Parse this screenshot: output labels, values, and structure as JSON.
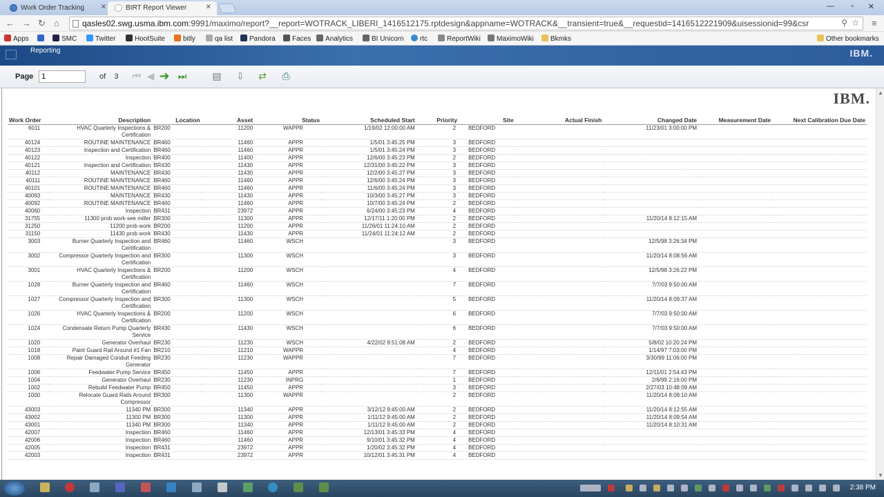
{
  "browser": {
    "tabs": [
      {
        "label": "Work Order Tracking",
        "active": false
      },
      {
        "label": "BIRT Report Viewer",
        "active": true
      }
    ],
    "url_host": "qasles02.swg.usma.ibm.com",
    "url_rest": ":9991/maximo/report?__report=WOTRACK_LIBERI_1416512175.rptdesign&appname=WOTRACK&__transient=true&__requestid=1416512221909&uisessionid=99&csr",
    "bookmarks": [
      "Apps",
      "SMC",
      "Twitter",
      "HootSuite",
      "bitly",
      "qa list",
      "Pandora",
      "Faces",
      "Analytics",
      "BI Unicorn",
      "rtc",
      "ReportWiki",
      "MaximoWiki",
      "Bkmks"
    ],
    "other_bookmarks": "Other bookmarks"
  },
  "app": {
    "section": "Reporting",
    "brand": "IBM."
  },
  "toolbar": {
    "page_label": "Page",
    "page_value": "1",
    "of_label": "of",
    "total_pages": "3"
  },
  "report": {
    "logo": "IBM.",
    "columns": [
      "Work Order",
      "Description",
      "Location",
      "Asset",
      "Status",
      "Scheduled Start",
      "Priority",
      "Site",
      "Actual Finish",
      "Changed Date",
      "Measurement Date",
      "Next Calibration Due Date"
    ],
    "rows": [
      [
        "6011",
        "HVAC Quarterly Inspections & Certification",
        "BR200",
        "11200",
        "WAPPR",
        "1/19/02   12:00:00 AM",
        "2",
        "BEDFORD",
        "",
        "11/23/01    3:00:00 PM",
        "",
        ""
      ],
      [
        "40124",
        "ROUTINE MAINTENANCE",
        "BR460",
        "11460",
        "APPR",
        "1/5/01   3:45:25 PM",
        "3",
        "BEDFORD",
        "",
        "",
        "",
        ""
      ],
      [
        "40123",
        "Inspection and Certification",
        "BR460",
        "11460",
        "APPR",
        "1/5/01   3:45:24 PM",
        "3",
        "BEDFORD",
        "",
        "",
        "",
        ""
      ],
      [
        "40122",
        "Inspection",
        "BR400",
        "11400",
        "APPR",
        "12/6/00   3:45:23 PM",
        "2",
        "BEDFORD",
        "",
        "",
        "",
        ""
      ],
      [
        "40121",
        "Inspection and Certification",
        "BR430",
        "11430",
        "APPR",
        "12/31/00   3:45:22 PM",
        "3",
        "BEDFORD",
        "",
        "",
        "",
        ""
      ],
      [
        "40112",
        "MAINTENANCE",
        "BR430",
        "11430",
        "APPR",
        "12/2/00   3:45:27 PM",
        "3",
        "BEDFORD",
        "",
        "",
        "",
        ""
      ],
      [
        "40111",
        "ROUTINE MAINTENANCE",
        "BR460",
        "11460",
        "APPR",
        "12/6/00   3:45:24 PM",
        "3",
        "BEDFORD",
        "",
        "",
        "",
        ""
      ],
      [
        "40101",
        "ROUTINE MAINTENANCE",
        "BR460",
        "11460",
        "APPR",
        "11/6/00   3:45:24 PM",
        "3",
        "BEDFORD",
        "",
        "",
        "",
        ""
      ],
      [
        "40093",
        "MAINTENANCE",
        "BR430",
        "11430",
        "APPR",
        "10/3/00   3:45:27 PM",
        "3",
        "BEDFORD",
        "",
        "",
        "",
        ""
      ],
      [
        "40092",
        "ROUTINE MAINTENANCE",
        "BR460",
        "11460",
        "APPR",
        "10/7/00   3:45:24 PM",
        "2",
        "BEDFORD",
        "",
        "",
        "",
        ""
      ],
      [
        "40060",
        "Inspection",
        "BR431",
        "23972",
        "APPR",
        "6/24/00   3:45:23 PM",
        "4",
        "BEDFORD",
        "",
        "",
        "",
        ""
      ],
      [
        "31755",
        "11300 prob work-see miller",
        "BR300",
        "11300",
        "APPR",
        "12/17/11   1:20:00 PM",
        "2",
        "BEDFORD",
        "",
        "11/20/14    8:12:15 AM",
        "",
        ""
      ],
      [
        "31250",
        "11200 prob work",
        "BR200",
        "11200",
        "APPR",
        "11/26/01   11:24:10 AM",
        "2",
        "BEDFORD",
        "",
        "",
        "",
        ""
      ],
      [
        "31150",
        "11430 prob work",
        "BR430",
        "11430",
        "APPR",
        "11/24/01   11:24:12 AM",
        "2",
        "BEDFORD",
        "",
        "",
        "",
        ""
      ],
      [
        "3003",
        "Burner Quarterly Inspection and Certification",
        "BR460",
        "11460",
        "WSCH",
        "",
        "3",
        "BEDFORD",
        "",
        "12/5/98    3:26:34 PM",
        "",
        ""
      ],
      [
        "3002",
        "Compressor Quarterly Inspection and Certification",
        "BR300",
        "11300",
        "WSCH",
        "",
        "3",
        "BEDFORD",
        "",
        "11/20/14    8:08:56 AM",
        "",
        ""
      ],
      [
        "3001",
        "HVAC Quarterly Inspections & Certification",
        "BR200",
        "11200",
        "WSCH",
        "",
        "4",
        "BEDFORD",
        "",
        "12/5/98    3:26:22 PM",
        "",
        ""
      ],
      [
        "1028",
        "Burner Quarterly Inspection and Certification",
        "BR460",
        "11460",
        "WSCH",
        "",
        "7",
        "BEDFORD",
        "",
        "7/7/03    9:50:00 AM",
        "",
        ""
      ],
      [
        "1027",
        "Compressor Quarterly Inspection and Certification",
        "BR300",
        "11300",
        "WSCH",
        "",
        "5",
        "BEDFORD",
        "",
        "11/20/14    8:09:37 AM",
        "",
        ""
      ],
      [
        "1026",
        "HVAC Quarterly Inspections & Certification",
        "BR200",
        "11200",
        "WSCH",
        "",
        "6",
        "BEDFORD",
        "",
        "7/7/03    9:50:00 AM",
        "",
        ""
      ],
      [
        "1024",
        "Condensate Return Pump Quarterly Service",
        "BR430",
        "11430",
        "WSCH",
        "",
        "6",
        "BEDFORD",
        "",
        "7/7/03    9:50:00 AM",
        "",
        ""
      ],
      [
        "1020",
        "Generator Overhaul",
        "BR230",
        "11230",
        "WSCH",
        "4/22/02   9:51:08 AM",
        "2",
        "BEDFORD",
        "",
        "5/8/02    10:20:24 PM",
        "",
        ""
      ],
      [
        "1018",
        "Paint Guard Rail Around #1 Fan",
        "BR210",
        "11210",
        "WAPPR",
        "",
        "4",
        "BEDFORD",
        "",
        "1/14/97    7:03:00 PM",
        "",
        ""
      ],
      [
        "1008",
        "Repair Damaged Conduit Feeding Generator",
        "BR230",
        "11230",
        "WAPPR",
        "",
        "7",
        "BEDFORD",
        "",
        "3/30/99    11:06:00 PM",
        "",
        ""
      ],
      [
        "1006",
        "Feedwater Pump Service",
        "BR450",
        "11450",
        "APPR",
        "",
        "7",
        "BEDFORD",
        "",
        "12/11/01    2:54:43 PM",
        "",
        ""
      ],
      [
        "1004",
        "Generator Overhaul",
        "BR230",
        "11230",
        "INPRG",
        "",
        "1",
        "BEDFORD",
        "",
        "2/6/99    2:16:00 PM",
        "",
        ""
      ],
      [
        "1002",
        "Rebuild Feedwater Pump",
        "BR450",
        "11450",
        "APPR",
        "",
        "3",
        "BEDFORD",
        "",
        "2/27/03    10:48:09 AM",
        "",
        ""
      ],
      [
        "1000",
        "Relocate Guard Rails Around Compressor",
        "BR300",
        "11300",
        "WAPPR",
        "",
        "2",
        "BEDFORD",
        "",
        "11/20/14    8:08:10 AM",
        "",
        ""
      ],
      [
        "43003",
        "11340 PM",
        "BR300",
        "11340",
        "APPR",
        "3/12/12   9:45:00 AM",
        "2",
        "BEDFORD",
        "",
        "11/20/14    8:12:55 AM",
        "",
        ""
      ],
      [
        "43002",
        "11300 PM",
        "BR300",
        "11300",
        "APPR",
        "1/11/12   9:45:00 AM",
        "2",
        "BEDFORD",
        "",
        "11/20/14    8:09:54 AM",
        "",
        ""
      ],
      [
        "43001",
        "11340 PM",
        "BR300",
        "11340",
        "APPR",
        "1/11/12   9:45:00 AM",
        "2",
        "BEDFORD",
        "",
        "11/20/14    8:10:31 AM",
        "",
        ""
      ],
      [
        "42007",
        "Inspection",
        "BR460",
        "11460",
        "APPR",
        "12/13/01   3:45:33 PM",
        "4",
        "BEDFORD",
        "",
        "",
        "",
        ""
      ],
      [
        "42006",
        "Inspection",
        "BR460",
        "11460",
        "APPR",
        "9/10/01   3:45:32 PM",
        "4",
        "BEDFORD",
        "",
        "",
        "",
        ""
      ],
      [
        "42005",
        "Inspection",
        "BR431",
        "23972",
        "APPR",
        "1/20/02   3:45:32 PM",
        "4",
        "BEDFORD",
        "",
        "",
        "",
        ""
      ],
      [
        "42003",
        "Inspection",
        "BR431",
        "23972",
        "APPR",
        "10/12/01   3:45:31 PM",
        "4",
        "BEDFORD",
        "",
        "",
        "",
        ""
      ]
    ]
  },
  "taskbar": {
    "clock": "2:38 PM"
  }
}
